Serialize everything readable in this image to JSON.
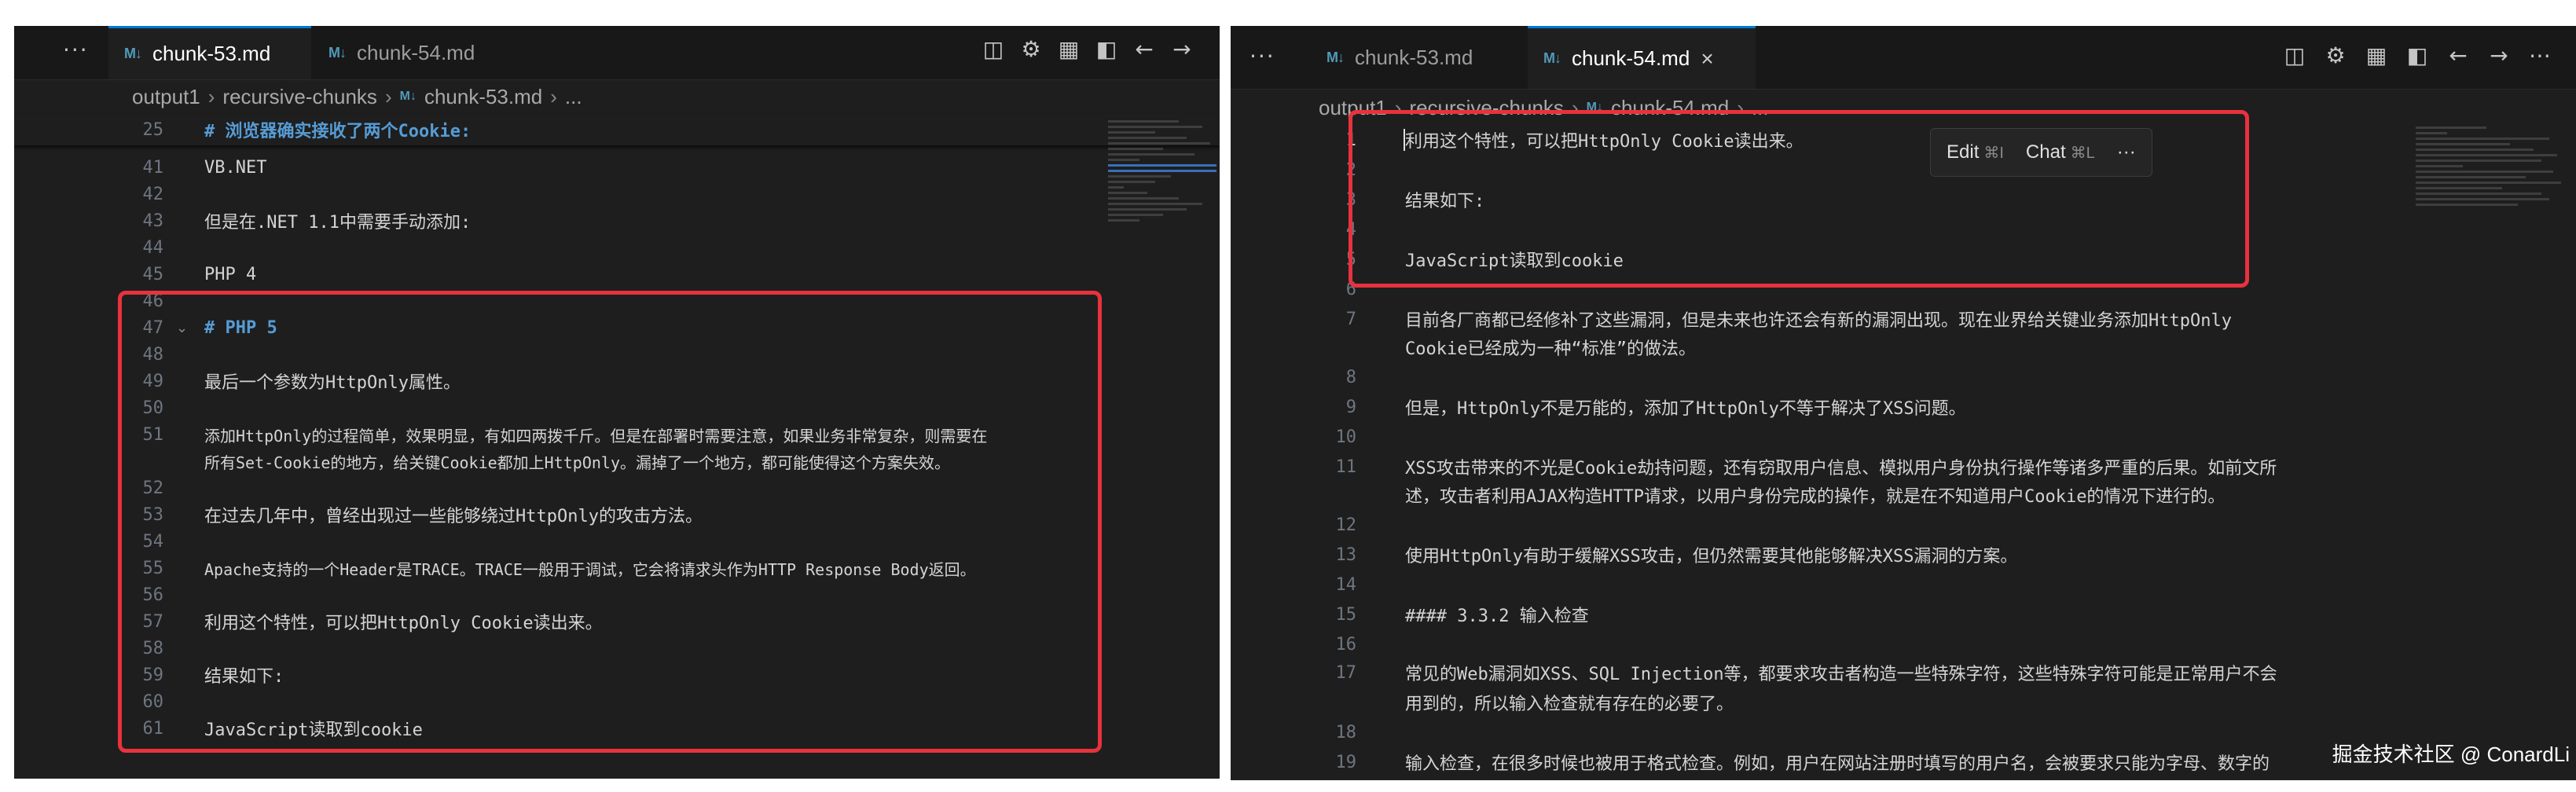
{
  "left": {
    "tabs": [
      {
        "label": "chunk-53.md",
        "active": true
      },
      {
        "label": "chunk-54.md",
        "active": false
      }
    ],
    "breadcrumb": [
      "output1",
      "recursive-chunks",
      "chunk-53.md",
      "..."
    ],
    "sticky": {
      "num": "25",
      "text": "# 浏览器确实接收了两个Cookie:"
    },
    "lines": [
      {
        "num": "41",
        "text": "VB.NET"
      },
      {
        "num": "42",
        "text": ""
      },
      {
        "num": "43",
        "text": "但是在.NET 1.1中需要手动添加:"
      },
      {
        "num": "44",
        "text": ""
      },
      {
        "num": "45",
        "text": "PHP 4"
      },
      {
        "num": "46",
        "text": ""
      },
      {
        "num": "47",
        "text": "# PHP 5"
      },
      {
        "num": "48",
        "text": ""
      },
      {
        "num": "49",
        "text": "最后一个参数为HttpOnly属性。"
      },
      {
        "num": "50",
        "text": ""
      },
      {
        "num": "51",
        "text": "添加HttpOnly的过程简单，效果明显，有如四两拨千斤。但是在部署时需要注意，如果业务非常复杂，则需要在"
      },
      {
        "num": "",
        "text": "所有Set-Cookie的地方，给关键Cookie都加上HttpOnly。漏掉了一个地方，都可能使得这个方案失效。"
      },
      {
        "num": "52",
        "text": ""
      },
      {
        "num": "53",
        "text": "在过去几年中，曾经出现过一些能够绕过HttpOnly的攻击方法。"
      },
      {
        "num": "54",
        "text": ""
      },
      {
        "num": "55",
        "text": "Apache支持的一个Header是TRACE。TRACE一般用于调试，它会将请求头作为HTTP Response Body返回。"
      },
      {
        "num": "56",
        "text": ""
      },
      {
        "num": "57",
        "text": "利用这个特性，可以把HttpOnly Cookie读出来。"
      },
      {
        "num": "58",
        "text": ""
      },
      {
        "num": "59",
        "text": "结果如下:"
      },
      {
        "num": "60",
        "text": ""
      },
      {
        "num": "61",
        "text": "JavaScript读取到cookie"
      }
    ]
  },
  "right": {
    "tabs": [
      {
        "label": "chunk-53.md",
        "active": false
      },
      {
        "label": "chunk-54.md",
        "active": true
      }
    ],
    "breadcrumb": [
      "output1",
      "recursive-chunks",
      "chunk-54.md",
      "..."
    ],
    "hover_bar": {
      "edit": "Edit",
      "edit_kb": "⌘I",
      "chat": "Chat",
      "chat_kb": "⌘L",
      "more": "···"
    },
    "lines": [
      {
        "num": "1",
        "text": "利用这个特性，可以把HttpOnly Cookie读出来。"
      },
      {
        "num": "2",
        "text": ""
      },
      {
        "num": "3",
        "text": "结果如下:"
      },
      {
        "num": "4",
        "text": ""
      },
      {
        "num": "5",
        "text": "JavaScript读取到cookie"
      },
      {
        "num": "6",
        "text": ""
      },
      {
        "num": "7",
        "text": "目前各厂商都已经修补了这些漏洞，但是未来也许还会有新的漏洞出现。现在业界给关键业务添加HttpOnly"
      },
      {
        "num": "",
        "text": "Cookie已经成为一种“标准”的做法。"
      },
      {
        "num": "8",
        "text": ""
      },
      {
        "num": "9",
        "text": "但是，HttpOnly不是万能的，添加了HttpOnly不等于解决了XSS问题。"
      },
      {
        "num": "10",
        "text": ""
      },
      {
        "num": "11",
        "text": "XSS攻击带来的不光是Cookie劫持问题，还有窃取用户信息、模拟用户身份执行操作等诸多严重的后果。如前文所"
      },
      {
        "num": "",
        "text": "述，攻击者利用AJAX构造HTTP请求，以用户身份完成的操作，就是在不知道用户Cookie的情况下进行的。"
      },
      {
        "num": "12",
        "text": ""
      },
      {
        "num": "13",
        "text": "使用HttpOnly有助于缓解XSS攻击，但仍然需要其他能够解决XSS漏洞的方案。"
      },
      {
        "num": "14",
        "text": ""
      },
      {
        "num": "15",
        "text": "#### 3.3.2 输入检查"
      },
      {
        "num": "16",
        "text": ""
      },
      {
        "num": "17",
        "text": "常见的Web漏洞如XSS、SQL Injection等，都要求攻击者构造一些特殊字符，这些特殊字符可能是正常用户不会"
      },
      {
        "num": "",
        "text": "用到的，所以输入检查就有存在的必要了。"
      },
      {
        "num": "18",
        "text": ""
      },
      {
        "num": "19",
        "text": "输入检查，在很多时候也被用于格式检查。例如，用户在网站注册时填写的用户名，会被要求只能为字母、数字的"
      }
    ],
    "watermark": "掘金技术社区 @ ConardLi"
  },
  "colors": {
    "editor_bg": "#1e1e1e",
    "tab_accent": "#0078d4",
    "heading": "#569cd6",
    "highlight_box": "#e8323e"
  }
}
